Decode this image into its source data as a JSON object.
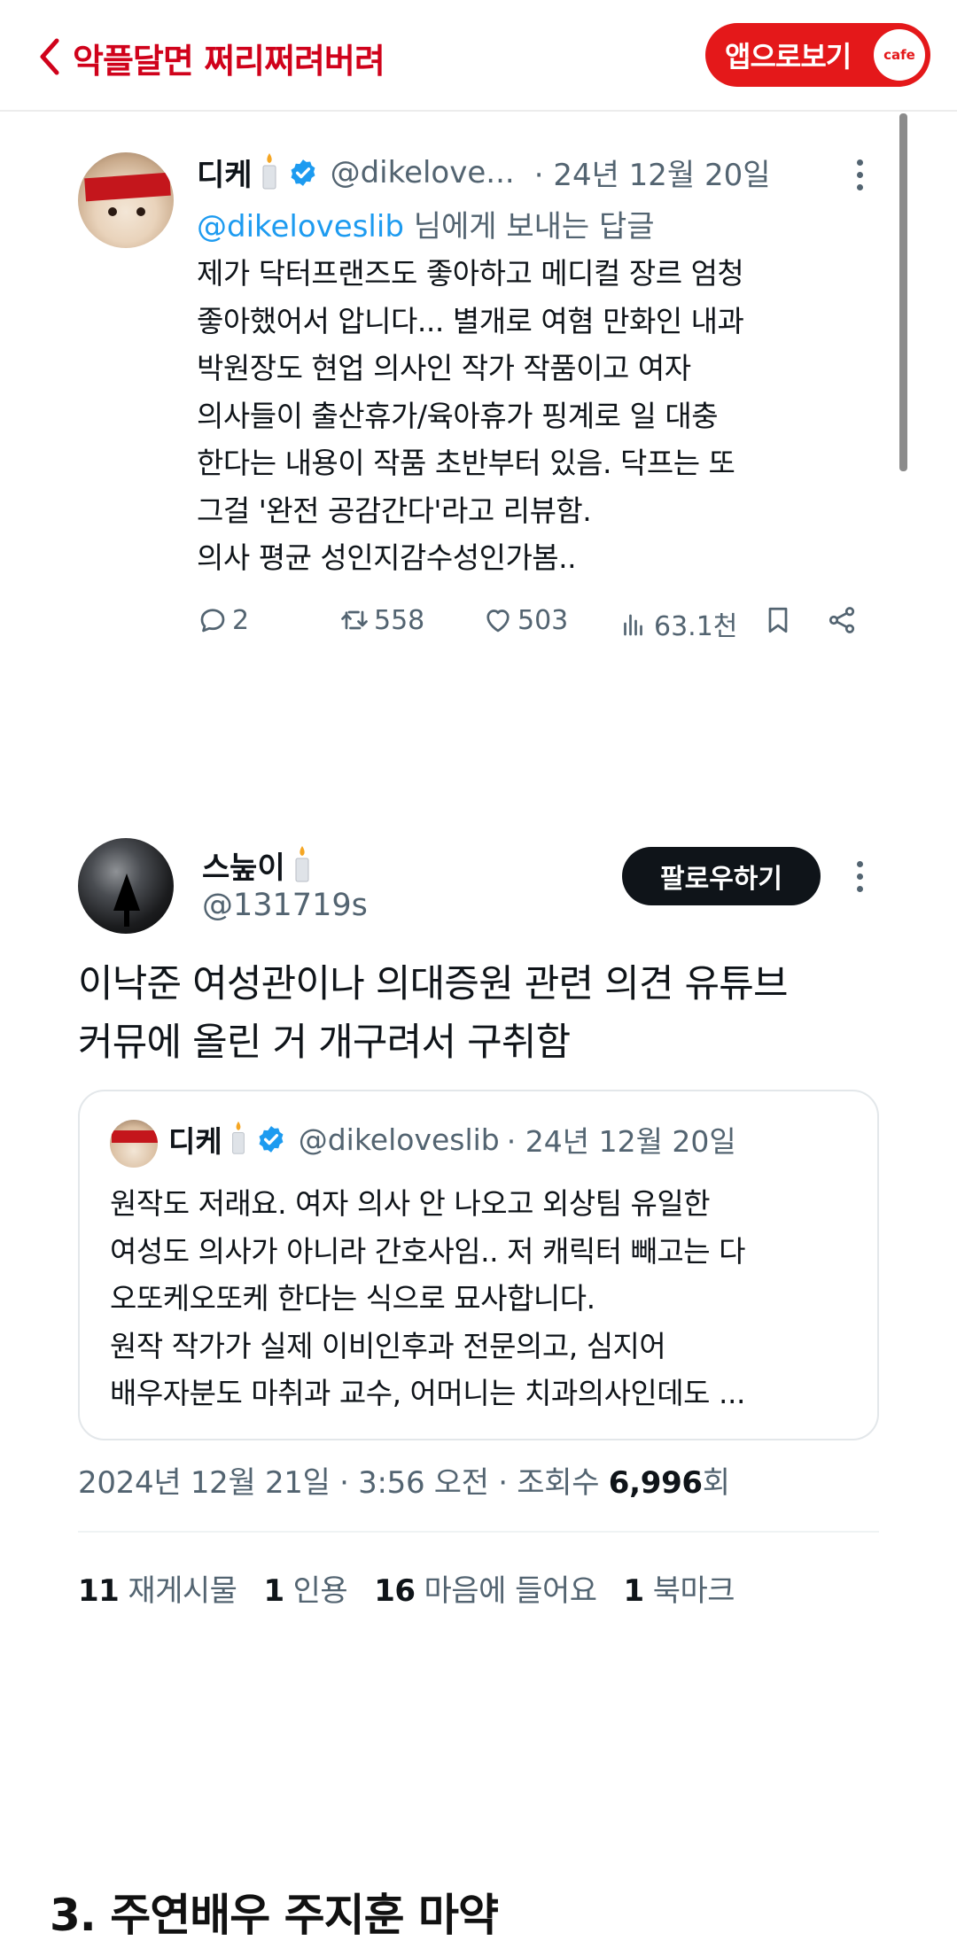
{
  "topbar": {
    "title": "악플달면 쩌리쩌려버려",
    "app_button": "앱으로보기",
    "cafe_badge": "cafe"
  },
  "reply_tweet": {
    "display_name": "디케",
    "handle": "@dikelove...",
    "time": "· 24년 12월 20일",
    "reply_mention": "@dikeloveslib",
    "reply_suffix": " 님에게 보내는 답글",
    "lines": [
      "제가 닥터프랜즈도 좋아하고 메디컬 장르 엄청",
      "좋아했어서 압니다... 별개로 여혐 만화인 내과",
      "박원장도 현업 의사인 작가 작품이고 여자",
      "의사들이 출산휴가/육아휴가 핑계로 일 대충",
      "한다는 내용이 작품 초반부터 있음. 닥프는 또",
      "그걸 '완전 공감간다'라고 리뷰함.",
      "의사 평균 성인지감수성인가봄.."
    ],
    "actions": {
      "replies": "2",
      "retweets": "558",
      "likes": "503",
      "views": "63.1천"
    }
  },
  "main_tweet": {
    "display_name": "스눞이",
    "handle": "@131719s",
    "follow_label": "팔로우하기",
    "text_lines": [
      "이낙준 여성관이나 의대증원 관련 의견 유튜브",
      "커뮤에 올린 거 개구려서 구취함"
    ],
    "quote": {
      "display_name": "디케",
      "handle": "@dikeloveslib",
      "time": "· 24년 12월 20일",
      "lines": [
        "원작도 저래요. 여자 의사 안 나오고 외상팀 유일한",
        "여성도 의사가 아니라 간호사임.. 저 캐릭터 빼고는 다",
        "오또케오또케 한다는 식으로 묘사합니다.",
        "원작 작가가 실제 이비인후과 전문의고, 심지어",
        "배우자분도 마취과 교수, 어머니는 치과의사인데도 ..."
      ]
    },
    "timestamp": "2024년 12월 21일 · 3:56 오전 · 조회수 ",
    "views_count": "6,996",
    "views_suffix": "회",
    "stats": [
      {
        "count": "11",
        "label": "재게시물"
      },
      {
        "count": "1",
        "label": "인용"
      },
      {
        "count": "16",
        "label": "마음에 들어요"
      },
      {
        "count": "1",
        "label": "북마크"
      }
    ]
  },
  "section_heading": "3. 주연배우 주지훈 마약",
  "colors": {
    "brand_red": "#e4181a",
    "link_blue": "#1d9bf0",
    "verified_blue": "#1d9bf0",
    "muted_gray": "#536471"
  }
}
